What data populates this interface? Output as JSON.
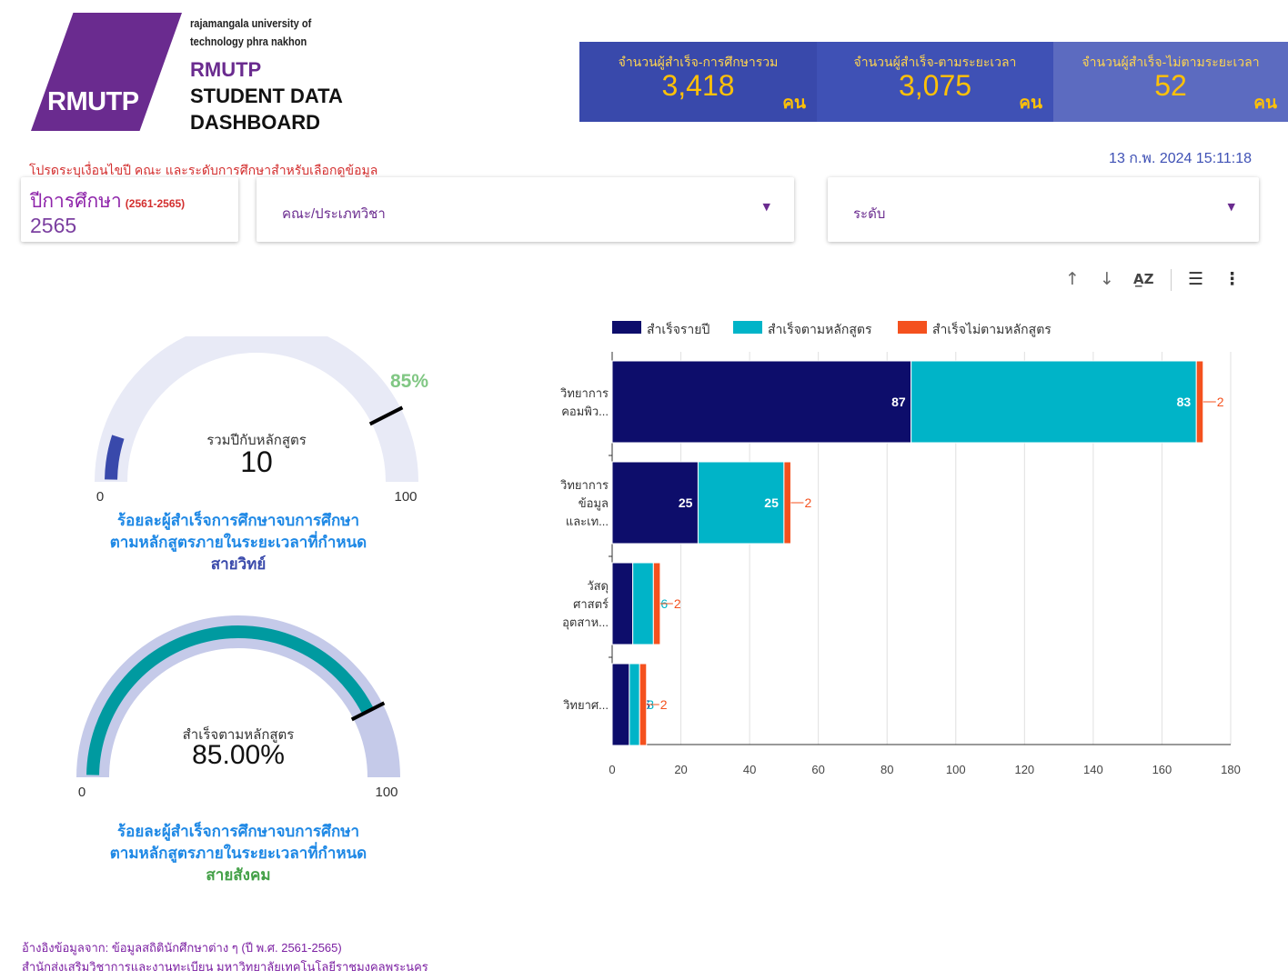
{
  "header": {
    "logo_text": "RMUTP",
    "university_line1": "rajamangala university of",
    "university_line2": "technology phra nakhon",
    "brand": "RMUTP",
    "title_line1": "STUDENT DATA",
    "title_line2": "DASHBOARD"
  },
  "kpis": [
    {
      "label": "จำนวนผู้สำเร็จ-การศึกษารวม",
      "value": "3,418",
      "unit": "คน",
      "color": "#3949ab"
    },
    {
      "label": "จำนวนผู้สำเร็จ-ตามระยะเวลา",
      "value": "3,075",
      "unit": "คน",
      "color": "#3f51b5"
    },
    {
      "label": "จำนวนผู้สำเร็จ-ไม่ตามระยะเวลา",
      "value": "52",
      "unit": "คน",
      "color": "#5c6bc0"
    }
  ],
  "timestamp": "13 ก.พ. 2024 15:11:18",
  "instruction": "โปรดระบุเงื่อนไขปี คณะ และระดับการศึกษาสำหรับเลือกดูข้อมูล",
  "filters": {
    "year_title": "ปีการศึกษา",
    "year_range": "(2561-2565)",
    "year_value": "2565",
    "faculty_label": "คณะ/ประเภทวิชา",
    "level_label": "ระดับ"
  },
  "gauges": [
    {
      "center_label": "รวมปีกับหลักสูตร",
      "center_value": "10",
      "min": "0",
      "max": "100",
      "value": 10,
      "target": 85,
      "target_label": "85%",
      "title_line1": "ร้อยละผู้สำเร็จการศึกษาจบการศึกษา",
      "title_line2": "ตามหลักสูตรภายในระยะเวลาที่กำหนด",
      "title_line3": "สายวิทย์",
      "track_color": "#e8eaf6",
      "fill_color": "#3949ab",
      "line3_color": "#3949ab"
    },
    {
      "center_label": "สำเร็จตามหลักสูตร",
      "center_value": "85.00%",
      "min": "0",
      "max": "100",
      "value": 85,
      "target": 85,
      "title_line1": "ร้อยละผู้สำเร็จการศึกษาจบการศึกษา",
      "title_line2": "ตามหลักสูตรภายในระยะเวลาที่กำหนด",
      "title_line3": "สายสังคม",
      "track_color": "#c5cae9",
      "fill_color": "#009aa0",
      "line3_color": "#43a047"
    }
  ],
  "toolbar": {
    "sort_asc_icon": "↑",
    "sort_desc_icon": "↓",
    "sort_az_icon": "A̲Z",
    "filter_icon": "☰",
    "more_icon": "⋮"
  },
  "chart_data": {
    "type": "bar",
    "orientation": "horizontal",
    "stacked": true,
    "categories": [
      "วิทยาการ|คอมพิว...",
      "วิทยาการ|ข้อมูล|และเท...",
      "วัสดุ|ศาสตร์|อุตสาห...",
      "วิทยาศ..."
    ],
    "series": [
      {
        "name": "สำเร็จรายปี",
        "color": "#0d0d6b",
        "values": [
          87,
          25,
          6,
          5
        ],
        "labels": [
          "87",
          "25",
          "6",
          "5"
        ]
      },
      {
        "name": "สำเร็จตามหลักสูตร",
        "color": "#00b4c8",
        "values": [
          83,
          25,
          6,
          3
        ],
        "labels": [
          "83",
          "25",
          "6",
          "3"
        ]
      },
      {
        "name": "สำเร็จไม่ตามหลักสูตร",
        "color": "#f4511e",
        "values": [
          2,
          2,
          2,
          2
        ],
        "labels": [
          "2",
          "2",
          "2",
          "2"
        ]
      }
    ],
    "xlim": [
      0,
      180
    ],
    "xticks": [
      "0",
      "20",
      "40",
      "60",
      "80",
      "100",
      "120",
      "140",
      "160",
      "180"
    ],
    "grid": true,
    "legend": "top-left"
  },
  "footer": {
    "line1": "อ้างอิงข้อมูลจาก: ข้อมูลสถิตินักศึกษาต่าง ๆ (ปี พ.ศ. 2561-2565)",
    "line2": "สำนักส่งเสริมวิชาการและงานทะเบียน มหาวิทยาลัยเทคโนโลยีราชมงคลพระนคร"
  }
}
